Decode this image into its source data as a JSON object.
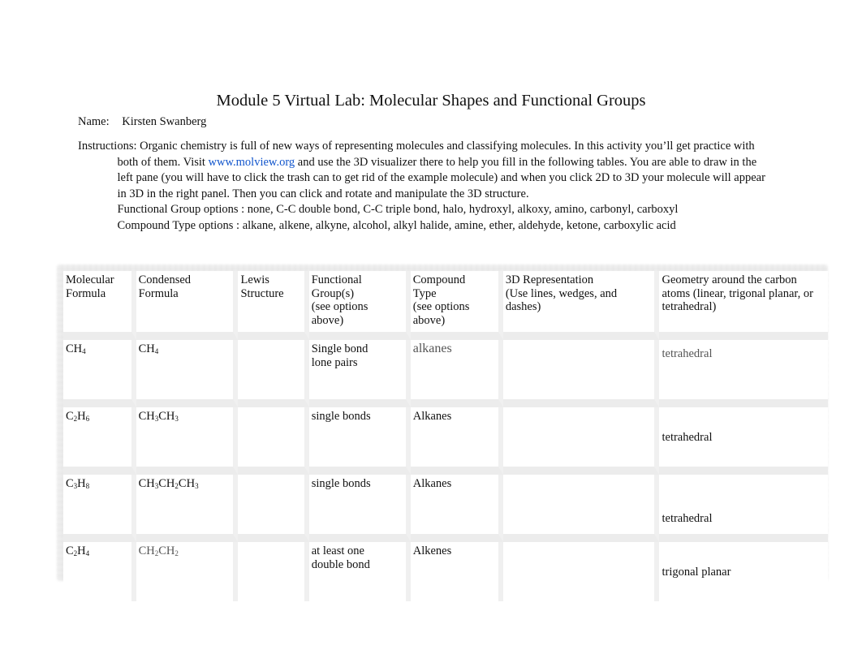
{
  "document": {
    "title": "Module 5 Virtual Lab: Molecular Shapes and Functional Groups",
    "name_label": "Name:",
    "name_value": "Kirsten Swanberg",
    "instructions_label": "Instructions:",
    "instructions_line1": "Organic chemistry is full of new ways of representing molecules and classifying molecules. In this activity you’ll get practice with",
    "instructions_line2a": "both of them. Visit",
    "instructions_link": "www.molview.org",
    "instructions_line2b": "and use the 3D visualizer there to help you fill in the following tables. You are able to draw in the",
    "instructions_line3": "left pane (you will have to click the trash can to get rid of the example molecule) and when you click 2D to 3D your molecule will appear",
    "instructions_line4": "in 3D in the right panel. Then you can click and rotate and manipulate the 3D structure.",
    "functional_group_options": "Functional Group options : none, C-C double bond, C-C triple bond, halo, hydroxyl, alkoxy, amino, carbonyl, carboxyl",
    "compound_type_options": "Compound Type options  : alkane, alkene, alkyne, alcohol, alkyl halide, amine, ether, aldehyde, ketone, carboxylic acid"
  },
  "colors": {
    "link": "#1155cc",
    "text": "#111111",
    "muted": "#555555"
  },
  "table": {
    "headers": [
      [
        "Molecular",
        "Formula"
      ],
      [
        "Condensed",
        "Formula"
      ],
      [
        "Lewis",
        "Structure"
      ],
      [
        "Functional",
        "Group(s)",
        "(see options",
        "above)"
      ],
      [
        "Compound",
        "Type",
        "(see options",
        "above)"
      ],
      [
        "3D Representation",
        "(Use lines, wedges, and",
        "dashes)"
      ],
      [
        "Geometry around the carbon",
        "atoms (linear, trigonal planar, or",
        "tetrahedral)"
      ]
    ],
    "rows": [
      {
        "molecular": [
          {
            "t": "CH"
          },
          {
            "s": "4"
          }
        ],
        "condensed": [
          {
            "t": "CH"
          },
          {
            "s": "4"
          }
        ],
        "lewis": "",
        "functional_group": [
          "Single bond",
          "lone pairs"
        ],
        "compound_type": "alkanes",
        "representation_3d": "",
        "geometry": "tetrahedral"
      },
      {
        "molecular": [
          {
            "t": "C"
          },
          {
            "s": "2"
          },
          {
            "t": "H"
          },
          {
            "s": "6"
          }
        ],
        "condensed": [
          {
            "t": "CH"
          },
          {
            "s": "3"
          },
          {
            "t": "CH"
          },
          {
            "s": "3"
          }
        ],
        "lewis": "",
        "functional_group": [
          "single bonds"
        ],
        "compound_type": "Alkanes",
        "representation_3d": "",
        "geometry": "tetrahedral"
      },
      {
        "molecular": [
          {
            "t": "C"
          },
          {
            "s": "3"
          },
          {
            "t": "H"
          },
          {
            "s": "8"
          }
        ],
        "condensed": [
          {
            "t": "CH"
          },
          {
            "s": "3"
          },
          {
            "t": "CH"
          },
          {
            "s": "2"
          },
          {
            "t": "CH"
          },
          {
            "s": "3"
          }
        ],
        "lewis": "",
        "functional_group": [
          "single bonds"
        ],
        "compound_type": "Alkanes",
        "representation_3d": "",
        "geometry": "tetrahedral"
      },
      {
        "molecular": [
          {
            "t": "C"
          },
          {
            "s": "2"
          },
          {
            "t": "H"
          },
          {
            "s": "4"
          }
        ],
        "condensed": [
          {
            "t": "CH"
          },
          {
            "s": "2"
          },
          {
            "t": "CH"
          },
          {
            "s": "2"
          }
        ],
        "lewis": "",
        "functional_group": [
          "at least one",
          "double bond"
        ],
        "compound_type": "Alkenes",
        "representation_3d": "",
        "geometry": "trigonal planar"
      }
    ]
  }
}
